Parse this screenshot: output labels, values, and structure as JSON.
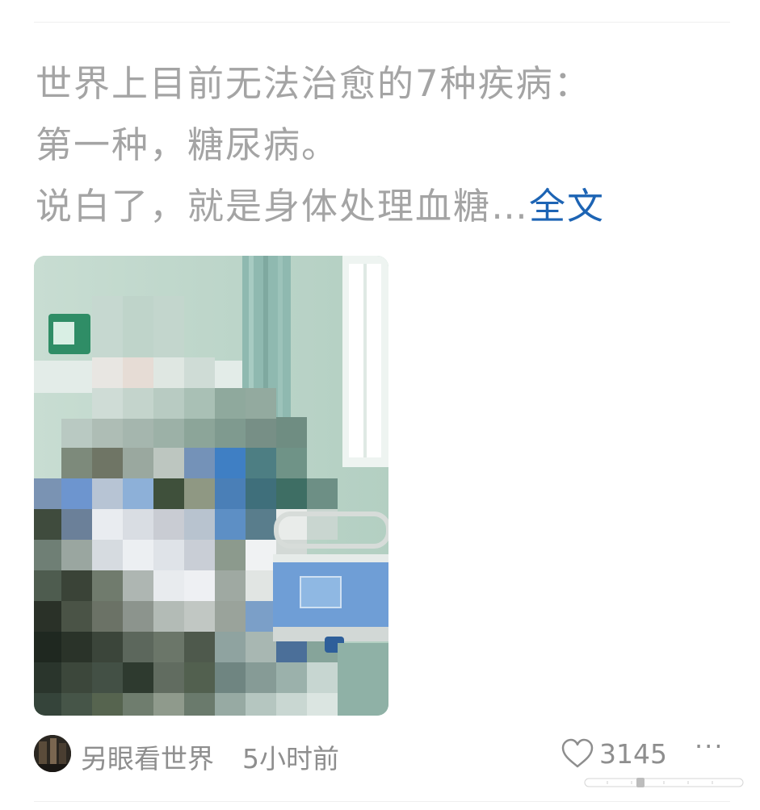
{
  "post": {
    "lines": [
      "世界上目前无法治愈的7种疾病：",
      "第一种，糖尿病。",
      "说白了，就是身体处理血糖…"
    ],
    "expand_label": "全文"
  },
  "image": {
    "description_icon": "hospital-ward-photo-icon"
  },
  "footer": {
    "author": "另眼看世界",
    "time": "5小时前",
    "like_count": "3145",
    "more_label": "···"
  },
  "colors": {
    "text_gray": "#a4a4a4",
    "link_blue": "#1d64b4",
    "meta_gray": "#8e8e8e"
  }
}
